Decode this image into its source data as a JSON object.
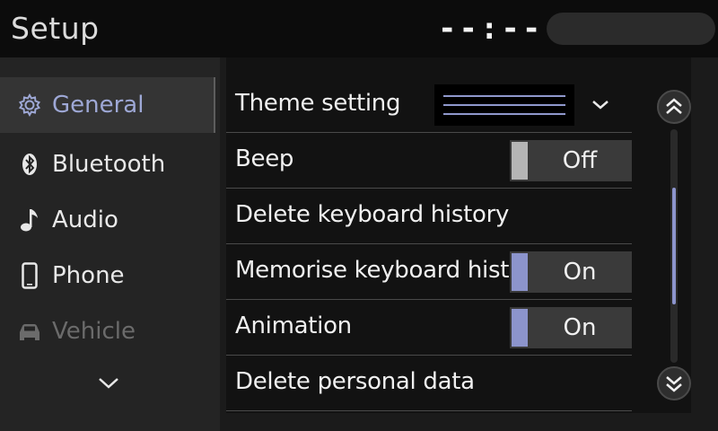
{
  "header": {
    "title": "Setup",
    "clock": "--:--"
  },
  "sidebar": {
    "items": [
      {
        "label": "General",
        "icon": "gear-icon",
        "active": true,
        "enabled": true
      },
      {
        "label": "Bluetooth",
        "icon": "bluetooth-icon",
        "active": false,
        "enabled": true
      },
      {
        "label": "Audio",
        "icon": "music-note-icon",
        "active": false,
        "enabled": true
      },
      {
        "label": "Phone",
        "icon": "phone-icon",
        "active": false,
        "enabled": true
      },
      {
        "label": "Vehicle",
        "icon": "car-icon",
        "active": false,
        "enabled": false
      }
    ],
    "more_icon": "chevron-down-icon"
  },
  "settings": {
    "rows": [
      {
        "label": "Theme setting",
        "control": "theme-dropdown"
      },
      {
        "label": "Beep",
        "control": "toggle",
        "value": "Off",
        "on": false
      },
      {
        "label": "Delete keyboard history",
        "control": "none"
      },
      {
        "label": "Memorise keyboard history",
        "control": "toggle",
        "value": "On",
        "on": true
      },
      {
        "label": "Animation",
        "control": "toggle",
        "value": "On",
        "on": true
      },
      {
        "label": "Delete personal data",
        "control": "none"
      }
    ]
  },
  "scrollbar": {
    "up_icon": "double-chevron-up-icon",
    "down_icon": "double-chevron-down-icon",
    "position_fraction": 0.25,
    "visible_fraction": 0.5
  },
  "colors": {
    "accent": "#8c94cc",
    "header_bg": "#0c0c0c",
    "sidebar_bg": "#242424",
    "list_bg": "#121212"
  }
}
